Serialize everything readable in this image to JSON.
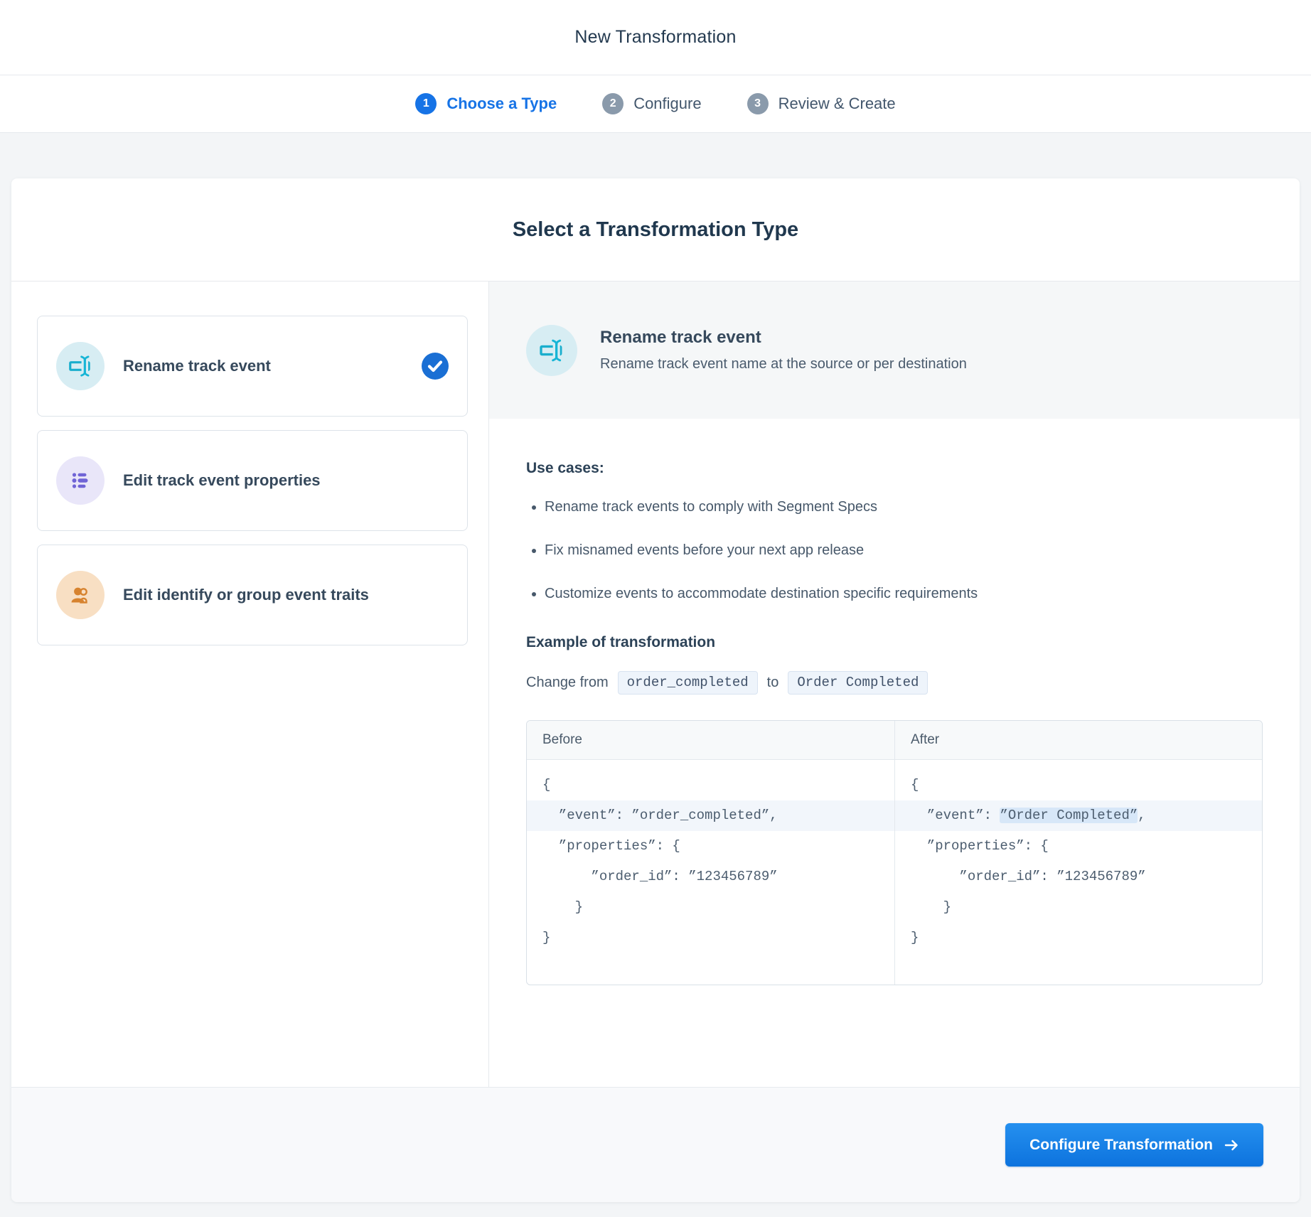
{
  "header": {
    "title": "New Transformation"
  },
  "stepper": {
    "steps": [
      {
        "number": "1",
        "label": "Choose a Type",
        "state": "active"
      },
      {
        "number": "2",
        "label": "Configure",
        "state": "inactive"
      },
      {
        "number": "3",
        "label": "Review & Create",
        "state": "inactive"
      }
    ]
  },
  "card": {
    "title": "Select a Transformation Type",
    "options": [
      {
        "label": "Rename track event",
        "icon": "rename-icon",
        "selected": true
      },
      {
        "label": "Edit track event properties",
        "icon": "list-icon",
        "selected": false
      },
      {
        "label": "Edit identify or group event traits",
        "icon": "users-icon",
        "selected": false
      }
    ],
    "detail": {
      "title": "Rename track event",
      "description": "Rename track event name at the source or per destination",
      "use_cases_heading": "Use cases:",
      "use_cases": [
        "Rename track events to comply with Segment Specs",
        "Fix misnamed events before your next app release",
        "Customize events to accommodate destination specific requirements"
      ],
      "example_heading": "Example of transformation",
      "change_prefix": "Change from",
      "change_from_code": "order_completed",
      "change_connector": "to",
      "change_to_code": "Order Completed",
      "comparison": {
        "before_label": "Before",
        "after_label": "After",
        "before_lines": [
          {
            "text": "{"
          },
          {
            "text": "  ”event”: ”order_completed”,",
            "highlight": true
          },
          {
            "text": "  ”properties”: {"
          },
          {
            "text": "      ”order_id”: ”123456789”"
          },
          {
            "text": "    }"
          },
          {
            "text": "}"
          }
        ],
        "after_lines": [
          {
            "text": "{"
          },
          {
            "prefix": "  ”event”: ",
            "token": "”Order Completed”",
            "suffix": ",",
            "highlight": true
          },
          {
            "text": "  ”properties”: {"
          },
          {
            "text": "      ”order_id”: ”123456789”"
          },
          {
            "text": "    }"
          },
          {
            "text": "}"
          }
        ]
      }
    },
    "footer": {
      "button_label": "Configure Transformation"
    }
  },
  "colors": {
    "accent_blue": "#1673e6",
    "check_blue": "#1a6fd4",
    "inactive_gray": "#8a9aab",
    "teal_icon": "#19aecd",
    "purple_icon": "#7064d6",
    "orange_icon": "#d7832f",
    "row_highlight": "#f2f6fb",
    "token_highlight": "#d7e7f8"
  }
}
